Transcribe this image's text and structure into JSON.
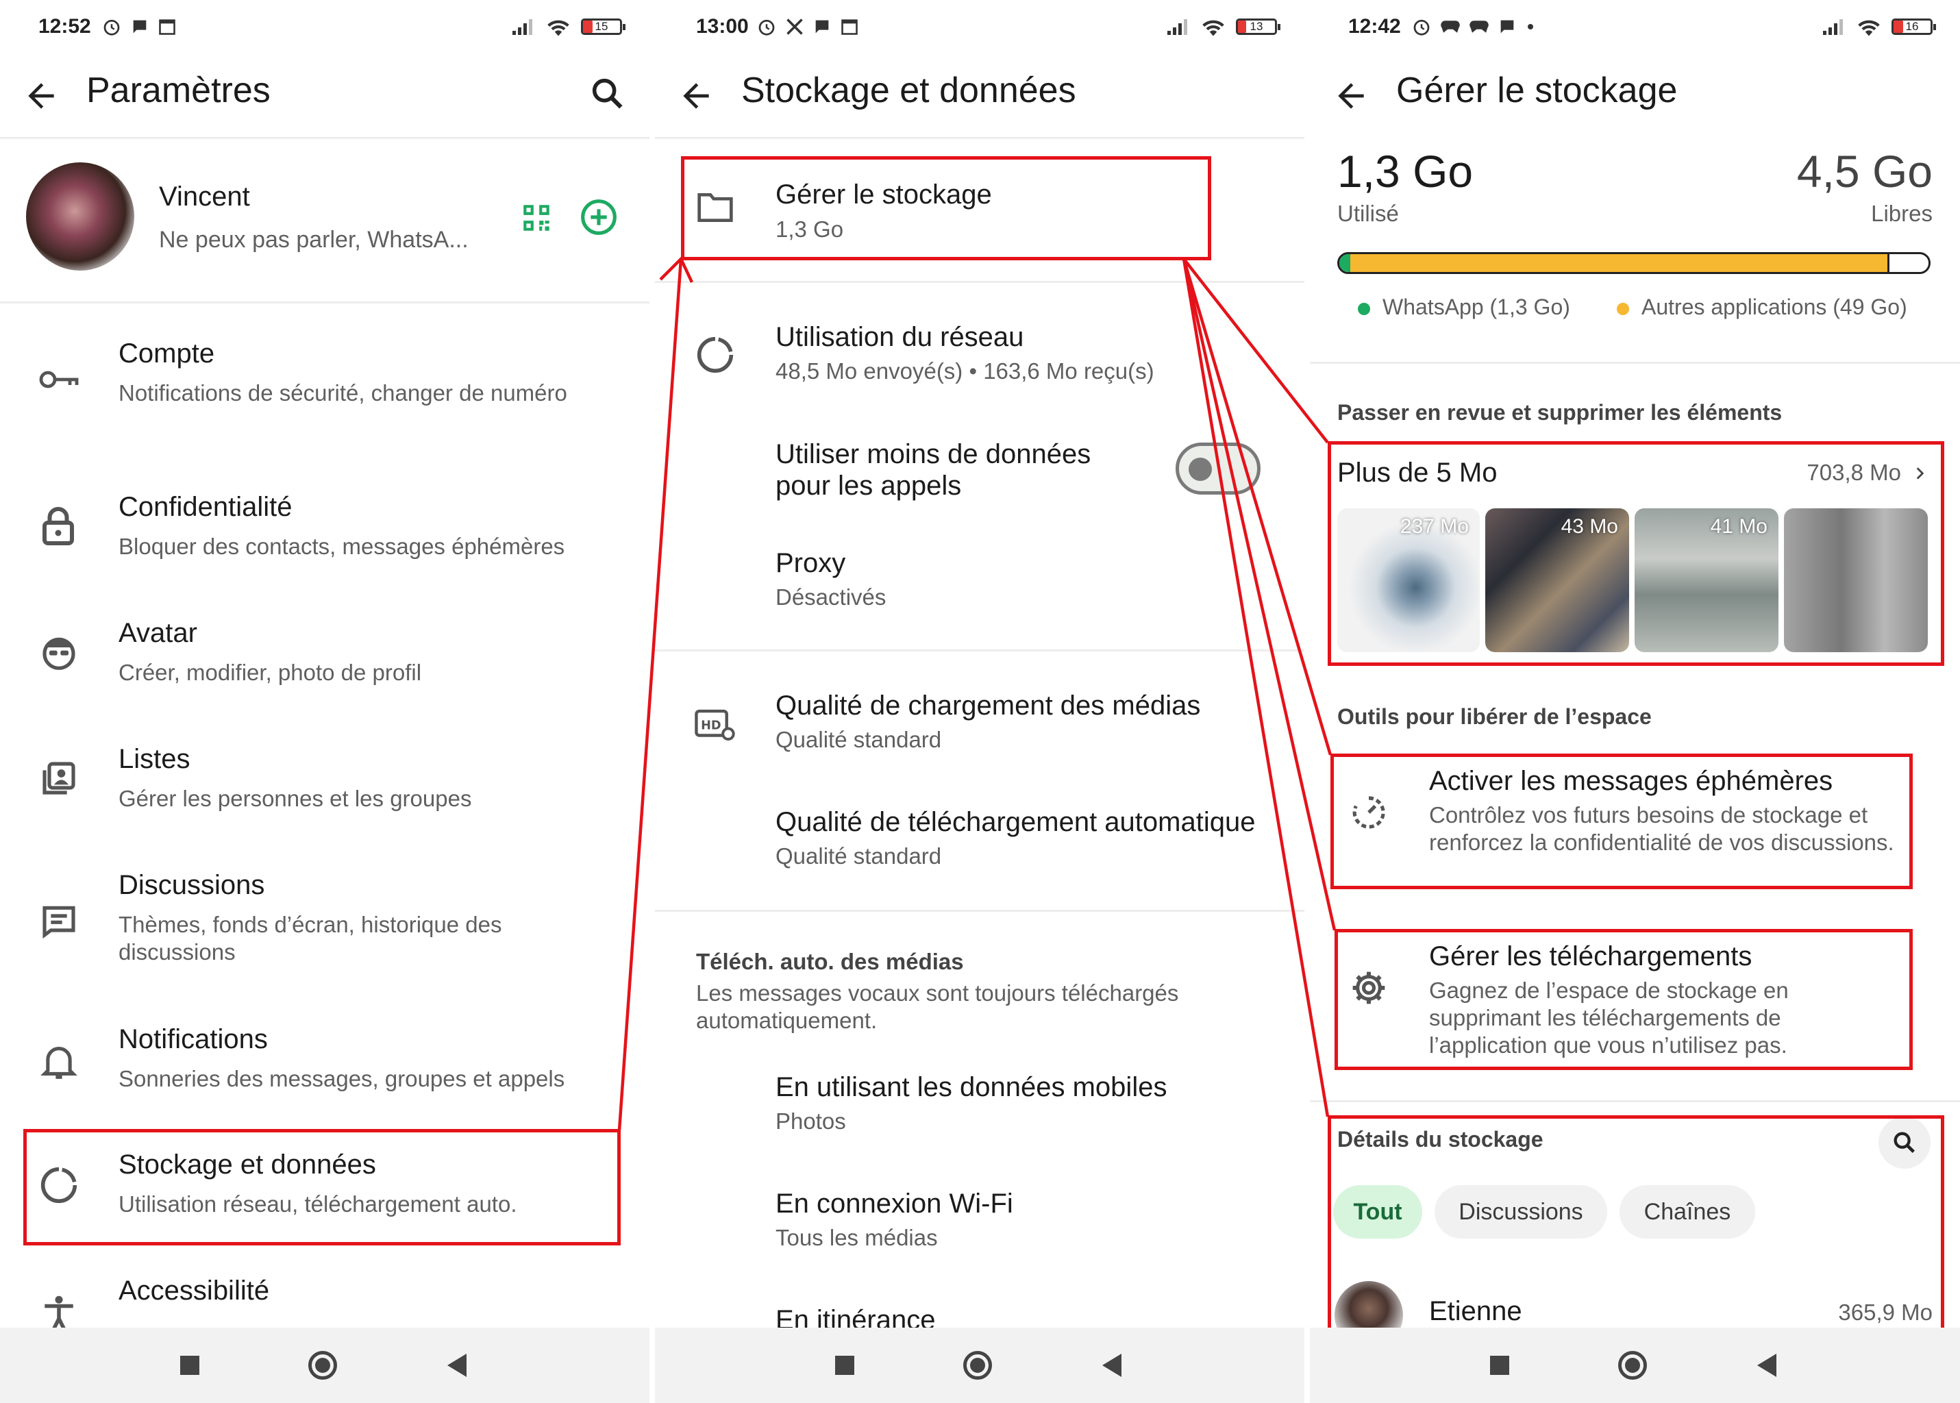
{
  "colors": {
    "accent_green": "#1daa61",
    "highlight_red": "#e4131a",
    "used_bar": "#f6b731"
  },
  "screen1": {
    "status": {
      "time": "12:52",
      "battery": "15"
    },
    "title": "Paramètres",
    "profile": {
      "name": "Vincent",
      "status": "Ne peux pas parler, WhatsA..."
    },
    "items": [
      {
        "icon": "key-icon",
        "title": "Compte",
        "subtitle": "Notifications de sécurité, changer de numéro"
      },
      {
        "icon": "lock-icon",
        "title": "Confidentialité",
        "subtitle": "Bloquer des contacts, messages éphémères"
      },
      {
        "icon": "avatar-icon",
        "title": "Avatar",
        "subtitle": "Créer, modifier, photo de profil"
      },
      {
        "icon": "lists-icon",
        "title": "Listes",
        "subtitle": "Gérer les personnes et les groupes"
      },
      {
        "icon": "chat-icon",
        "title": "Discussions",
        "subtitle": "Thèmes, fonds d’écran, historique des discussions"
      },
      {
        "icon": "bell-icon",
        "title": "Notifications",
        "subtitle": "Sonneries des messages, groupes et appels"
      },
      {
        "icon": "storage-icon",
        "title": "Stockage et données",
        "subtitle": "Utilisation réseau, téléchargement auto."
      },
      {
        "icon": "accessibility-icon",
        "title": "Accessibilité",
        "subtitle": ""
      }
    ]
  },
  "screen2": {
    "status": {
      "time": "13:00",
      "battery": "13"
    },
    "title": "Stockage et données",
    "manage": {
      "title": "Gérer le stockage",
      "subtitle": "1,3 Go"
    },
    "network": {
      "title": "Utilisation du réseau",
      "subtitle": "48,5 Mo envoyé(s) • 163,6 Mo reçu(s)"
    },
    "less_data": {
      "title": "Utiliser moins de données pour les appels",
      "toggle_on": false
    },
    "proxy": {
      "title": "Proxy",
      "subtitle": "Désactivés"
    },
    "upload_quality": {
      "title": "Qualité de chargement des médias",
      "subtitle": "Qualité standard"
    },
    "download_quality": {
      "title": "Qualité de téléchargement automatique",
      "subtitle": "Qualité standard"
    },
    "auto_download": {
      "header": "Téléch. auto. des médias",
      "note": "Les messages vocaux sont toujours téléchargés automatiquement."
    },
    "mobile": {
      "title": "En utilisant les données mobiles",
      "subtitle": "Photos"
    },
    "wifi": {
      "title": "En connexion Wi-Fi",
      "subtitle": "Tous les médias"
    },
    "roaming": {
      "title": "En itinérance"
    }
  },
  "screen3": {
    "status": {
      "time": "12:42",
      "battery": "16"
    },
    "title": "Gérer le stockage",
    "used": {
      "value": "1,3 Go",
      "label": "Utilisé"
    },
    "free": {
      "value": "4,5 Go",
      "label": "Libres"
    },
    "bar": {
      "whatsapp_fraction": 0.019,
      "others_fraction": 0.915
    },
    "legend": {
      "whatsapp": "WhatsApp (1,3 Go)",
      "others": "Autres applications (49 Go)"
    },
    "review_header": "Passer en revue et supprimer les éléments",
    "large_files": {
      "title": "Plus de 5 Mo",
      "size": "703,8 Mo",
      "thumbs": [
        "237 Mo",
        "43 Mo",
        "41 Mo",
        ""
      ]
    },
    "tools_header": "Outils pour libérer de l’espace",
    "ephemeral": {
      "title": "Activer les messages éphémères",
      "subtitle": "Contrôlez vos futurs besoins de stockage et renforcez la confidentialité de vos discussions."
    },
    "downloads": {
      "title": "Gérer les téléchargements",
      "subtitle": "Gagnez de l’espace de stockage en supprimant les téléchargements de l’application que vous n’utilisez pas."
    },
    "details": {
      "header": "Détails du stockage",
      "chips": [
        "Tout",
        "Discussions",
        "Chaînes"
      ],
      "contact": {
        "name": "Etienne",
        "size": "365,9 Mo"
      }
    }
  }
}
